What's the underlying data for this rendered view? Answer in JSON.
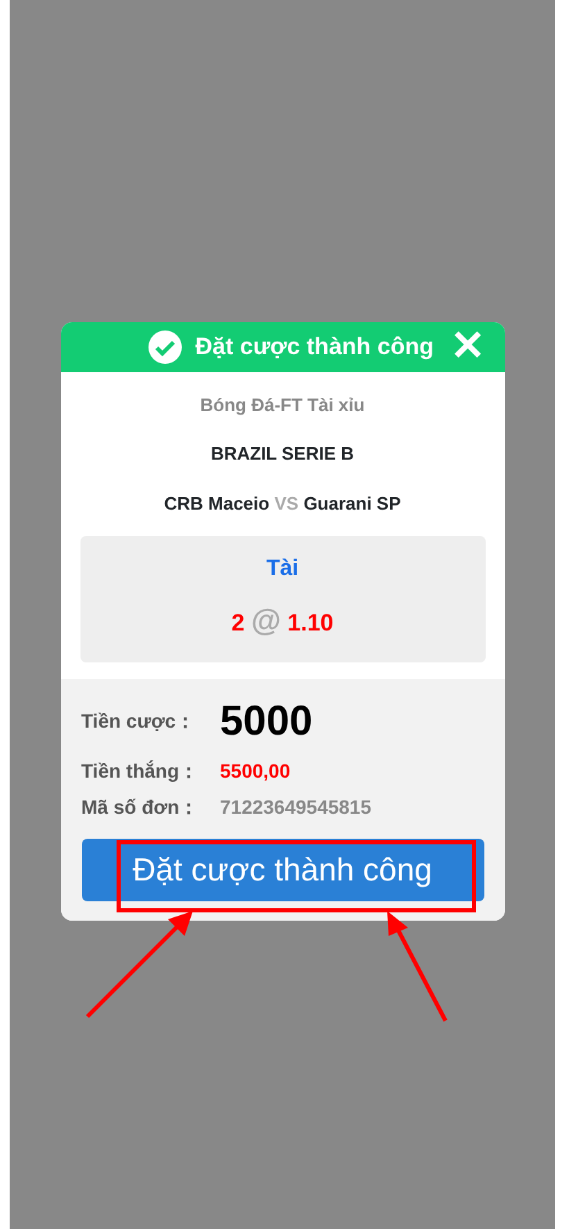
{
  "dialog": {
    "title": "Đặt cược thành công",
    "close": "✕",
    "sport": "Bóng Đá-FT Tài xỉu",
    "league": "BRAZIL SERIE B",
    "home": "CRB Maceio",
    "vs": "VS",
    "away": "Guarani SP",
    "pick": {
      "side": "Tài",
      "line": "2",
      "at": "@",
      "odds": "1.10"
    },
    "details": [
      {
        "kind": "stake",
        "label": "Tiền cược：",
        "value": "5000"
      },
      {
        "kind": "win",
        "label": "Tiền thắng：",
        "value": "5500,00"
      },
      {
        "kind": "ref",
        "label": "Mã số đơn：",
        "value": "71223649545815"
      }
    ],
    "button": "Đặt cược thành công"
  }
}
